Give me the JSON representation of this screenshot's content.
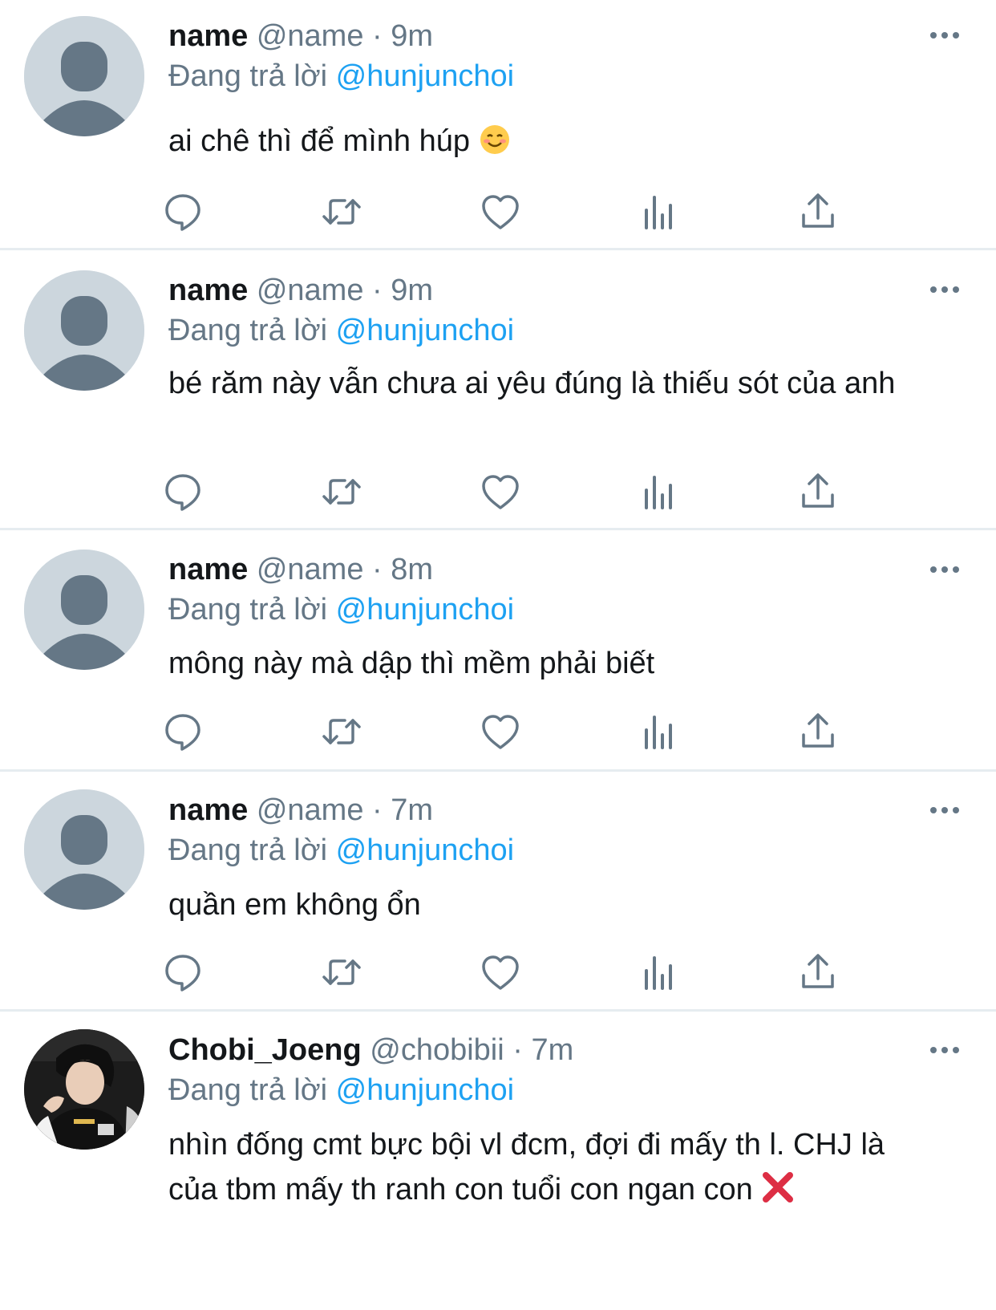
{
  "common": {
    "replying_label": "Đang trả lời",
    "dot": "·"
  },
  "tweets": [
    {
      "display_name": "name",
      "handle": "@name",
      "time": "9m",
      "reply_to": "@hunjunchoi",
      "text": "ai chê thì để mình húp",
      "emoji": "smiling-face-icon",
      "avatar": "default-avatar"
    },
    {
      "display_name": "name",
      "handle": "@name",
      "time": "9m",
      "reply_to": "@hunjunchoi",
      "text": "bé răm này vẫn chưa ai yêu đúng là thiếu sót của anh",
      "avatar": "default-avatar"
    },
    {
      "display_name": "name",
      "handle": "@name",
      "time": "8m",
      "reply_to": "@hunjunchoi",
      "text": "mông này mà dập thì mềm phải biết",
      "avatar": "default-avatar"
    },
    {
      "display_name": "name",
      "handle": "@name",
      "time": "7m",
      "reply_to": "@hunjunchoi",
      "text": "quần em không ổn",
      "avatar": "default-avatar"
    },
    {
      "display_name": "Chobi_Joeng",
      "handle": "@chobibii",
      "time": "7m",
      "reply_to": "@hunjunchoi",
      "text": "nhìn đống cmt bực bội vl đcm, đợi đi mấy th l. CHJ là của tbm mấy th ranh con tuổi con ngan con",
      "emoji": "red-x-icon",
      "avatar": "photo-avatar"
    }
  ],
  "colors": {
    "accent": "#1da1f2",
    "secondary_text": "#657786",
    "icon": "#657786",
    "separator": "#e6ecf0",
    "avatar_bg": "#ccd6dd"
  },
  "icons": [
    "reply-icon",
    "retweet-icon",
    "like-icon",
    "analytics-icon",
    "share-icon",
    "more-icon"
  ]
}
